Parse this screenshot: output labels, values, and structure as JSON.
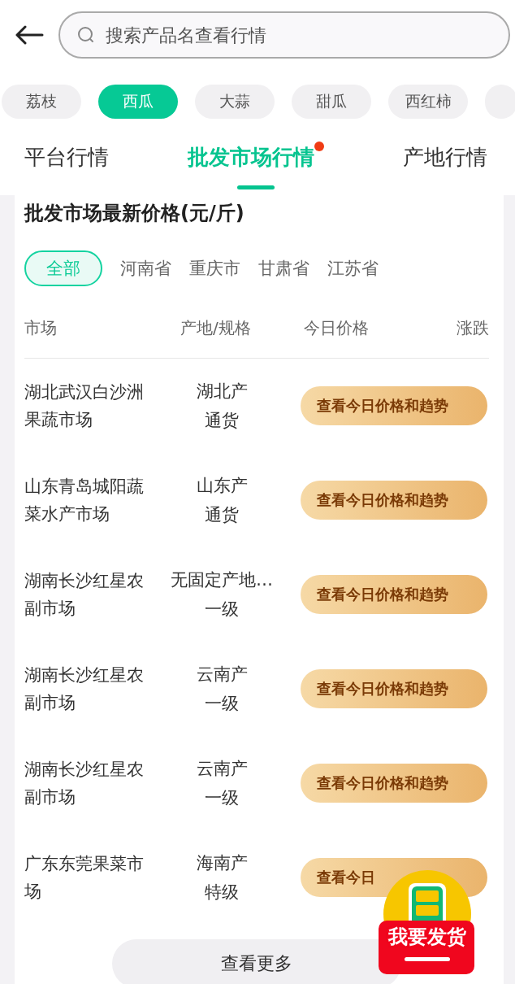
{
  "search": {
    "placeholder": "搜索产品名查看行情"
  },
  "categories": [
    {
      "label": "荔枝",
      "selected": false
    },
    {
      "label": "西瓜",
      "selected": true
    },
    {
      "label": "大蒜",
      "selected": false
    },
    {
      "label": "甜瓜",
      "selected": false
    },
    {
      "label": "西红柿",
      "selected": false
    }
  ],
  "tabs": [
    {
      "label": "平台行情",
      "selected": false,
      "dot": false
    },
    {
      "label": "批发市场行情",
      "selected": true,
      "dot": true
    },
    {
      "label": "产地行情",
      "selected": false,
      "dot": false
    }
  ],
  "card": {
    "title": "批发市场最新价格(元/斤)",
    "regions": [
      {
        "label": "全部",
        "selected": true
      },
      {
        "label": "河南省",
        "selected": false
      },
      {
        "label": "重庆市",
        "selected": false
      },
      {
        "label": "甘肃省",
        "selected": false
      },
      {
        "label": "江苏省",
        "selected": false
      }
    ],
    "columns": [
      "市场",
      "产地/规格",
      "今日价格",
      "涨跌"
    ],
    "rows": [
      {
        "market": "湖北武汉白沙洲果蔬市场",
        "origin": "湖北产",
        "grade": "通货",
        "action": "查看今日价格和趋势"
      },
      {
        "market": "山东青岛城阳蔬菜水产市场",
        "origin": "山东产",
        "grade": "通货",
        "action": "查看今日价格和趋势"
      },
      {
        "market": "湖南长沙红星农副市场",
        "origin": "无固定产地…",
        "grade": "一级",
        "action": "查看今日价格和趋势"
      },
      {
        "market": "湖南长沙红星农副市场",
        "origin": "云南产",
        "grade": "一级",
        "action": "查看今日价格和趋势"
      },
      {
        "market": "湖南长沙红星农副市场",
        "origin": "云南产",
        "grade": "一级",
        "action": "查看今日价格和趋势"
      },
      {
        "market": "广东东莞果菜市场",
        "origin": "海南产",
        "grade": "特级",
        "action": "查看今日"
      }
    ],
    "more": "查看更多"
  },
  "ship_button": {
    "label": "我要发货"
  }
}
